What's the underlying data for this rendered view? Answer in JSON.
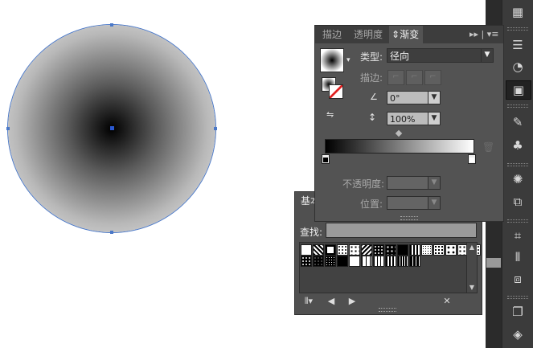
{
  "canvas": {
    "shape": "circle",
    "gradient": "radial black-to-white"
  },
  "gradient_panel": {
    "tabs": [
      {
        "label": "描边",
        "active": false
      },
      {
        "label": "透明度",
        "active": false
      },
      {
        "label": "渐变",
        "active": true
      }
    ],
    "tab_menu_glyph": "▸▸ | ▾≡",
    "type_label": "类型:",
    "type_value": "径向",
    "stroke_label": "描边:",
    "angle_value": "0°",
    "aspect_value": "100%",
    "gradient_stops": [
      {
        "position": 0,
        "color": "#000000"
      },
      {
        "position": 100,
        "color": "#ffffff"
      }
    ],
    "opacity_label": "不透明度:",
    "location_label": "位置:",
    "delete_icon": "trash-icon"
  },
  "swatches_panel": {
    "tab_label": "基本",
    "search_label": "查找:",
    "search_value": ""
  },
  "toolbar": {
    "icons": [
      "grid-icon",
      "menu-icon",
      "shapes-icon",
      "gradient-icon",
      "brush-icon",
      "club-icon",
      "symbol-icon",
      "transform-icon",
      "align-icon",
      "align-left-icon",
      "pathfinder-icon",
      "artboards-icon",
      "layers-icon"
    ]
  },
  "colors": {
    "selection": "#4a78c8",
    "panel_bg": "#535353",
    "tab_bg": "#3d3d3d"
  }
}
